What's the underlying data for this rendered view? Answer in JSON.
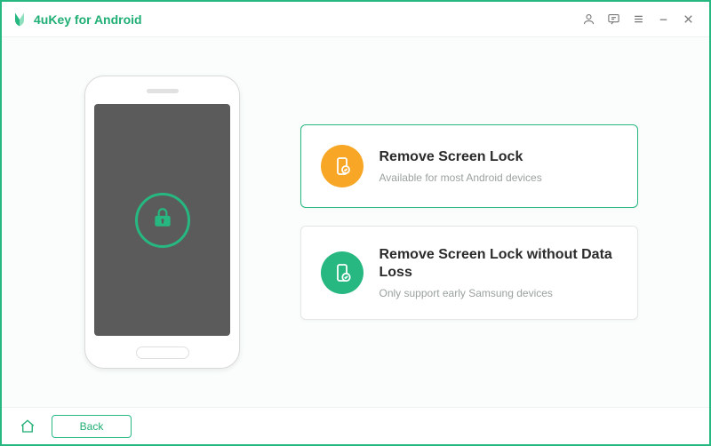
{
  "app": {
    "title": "4uKey for Android"
  },
  "options": [
    {
      "title": "Remove Screen Lock",
      "subtitle": "Available for most Android devices",
      "selected": true,
      "color": "orange"
    },
    {
      "title": "Remove Screen Lock without Data Loss",
      "subtitle": "Only support early Samsung devices",
      "selected": false,
      "color": "green"
    }
  ],
  "footer": {
    "back_label": "Back"
  }
}
